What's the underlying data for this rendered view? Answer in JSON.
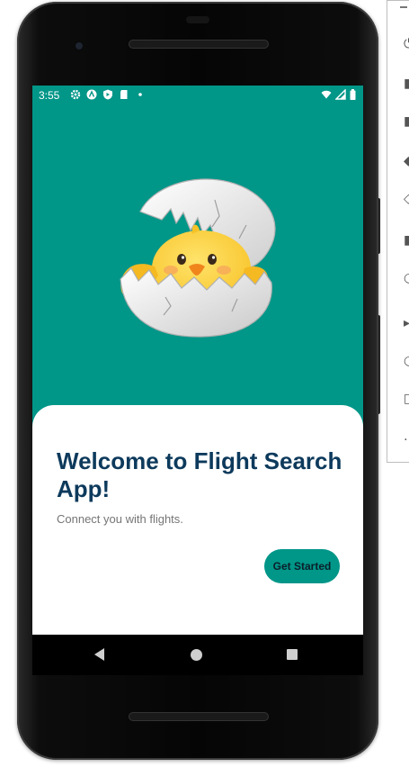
{
  "status_bar": {
    "time": "3:55",
    "left_icons": [
      "gear-icon",
      "android-auto-icon",
      "shield-icon",
      "sd-card-icon",
      "dot-icon"
    ],
    "right_icons": [
      "wifi-icon",
      "signal-icon",
      "battery-icon"
    ]
  },
  "welcome": {
    "title": "Welcome to Flight Search App!",
    "subtitle": "Connect you with flights.",
    "cta_label": "Get Started"
  },
  "nav_bar": {
    "icons": [
      "back-icon",
      "home-icon",
      "recents-icon"
    ]
  },
  "colors": {
    "primary": "#009688",
    "title": "#0d3a5c",
    "subtitle": "#757575",
    "surface": "#ffffff"
  }
}
